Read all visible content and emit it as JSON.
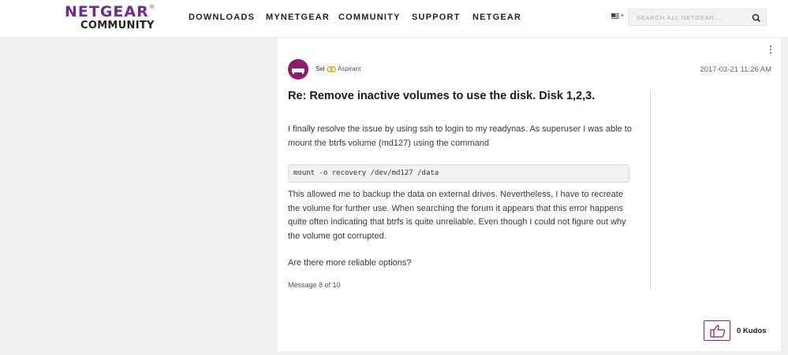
{
  "header": {
    "logo": {
      "brand": "NETGEAR",
      "reg": "®",
      "sub": "COMMUNITY"
    },
    "nav": [
      "DOWNLOADS",
      "MYNETGEAR",
      "COMMUNITY",
      "SUPPORT",
      "NETGEAR"
    ],
    "flag_icon": "us-flag-icon",
    "search": {
      "placeholder": "SEARCH ALL NETGEAR..."
    }
  },
  "post": {
    "author": "Sel",
    "rank": "Aspirant",
    "date": "2017-03-21 11:26 AM",
    "title": "Re: Remove inactive volumes to use the disk. Disk 1,2,3.",
    "paragraph1": "I finally resolve the issue by using ssh to login to my readynas. As superuser I was able to mount the btrfs volume (md127) using the command",
    "code": "mount -o recovery /dev/md127 /data",
    "paragraph2": "This allowed me to backup the data on external drives. Nevertheless, I have to recreate the volume for further use. When searching the forum it appears that this error happens quite often indicating that btrfs is quite unreliable. Even though I could not figure out why the volume got corrupted.",
    "paragraph3": "Are there more reliable options?",
    "message_number": "Message 8 of 10",
    "kudos": "0 Kudos"
  },
  "colors": {
    "brand_purple": "#6d2d8a",
    "avatar_magenta": "#8c1c6e",
    "page_bg": "#f0f0f0"
  }
}
